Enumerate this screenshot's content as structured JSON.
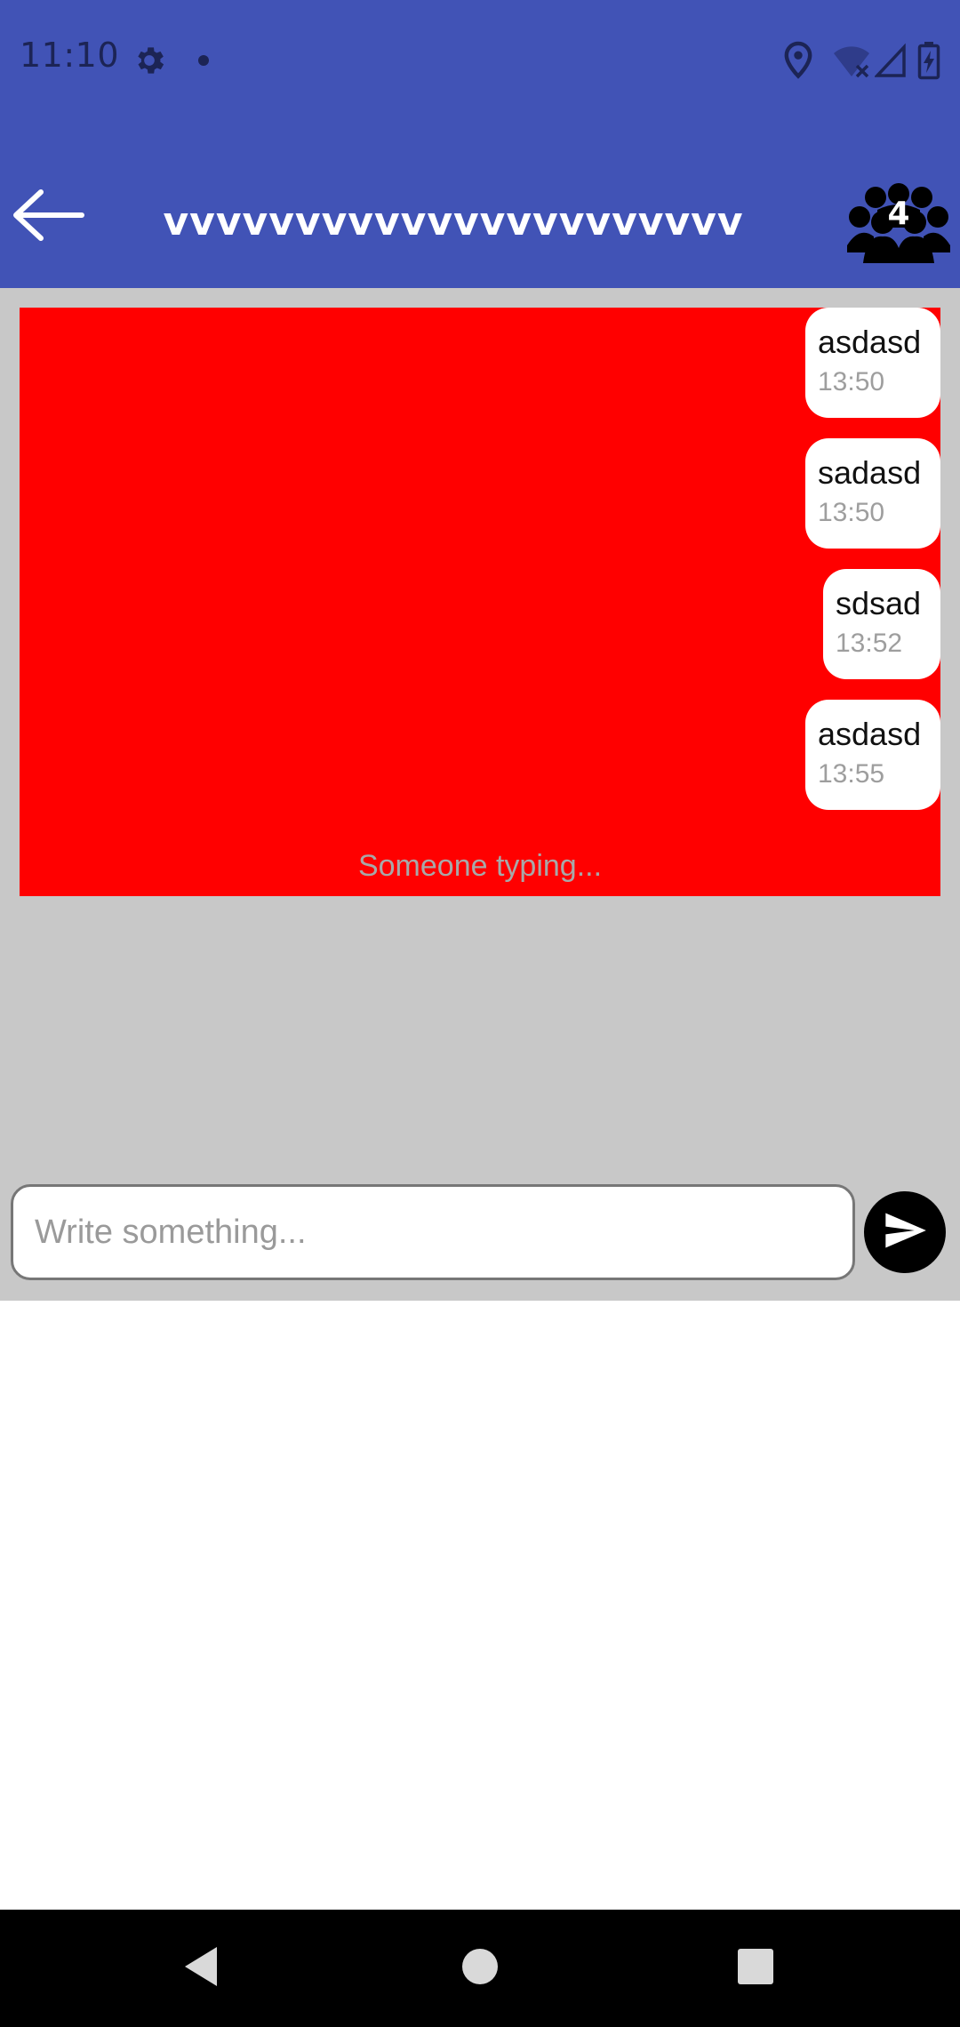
{
  "status_bar": {
    "time": "11:10",
    "icons": [
      "settings-icon",
      "notification-dot-icon",
      "location-icon",
      "wifi-off-icon",
      "cell-signal-icon",
      "battery-charging-icon"
    ]
  },
  "app_bar": {
    "title": "vvvvvvvvvvvvvvvvvvvvvv",
    "members_count": "4",
    "back_icon": "arrow-left-icon",
    "members_icon": "group-icon",
    "background_color": "#4153b6"
  },
  "chat": {
    "panel_color": "#ff0000",
    "messages": [
      {
        "text": "asdasd",
        "time": "13:50"
      },
      {
        "text": "sadasd",
        "time": "13:50"
      },
      {
        "text": "sdsad",
        "time": "13:52"
      },
      {
        "text": "asdasd",
        "time": "13:55"
      }
    ],
    "typing_text": "Someone typing..."
  },
  "composer": {
    "placeholder": "Write something...",
    "value": "",
    "send_icon": "send-icon"
  },
  "nav_bar": {
    "icons": [
      "back-triangle-icon",
      "home-circle-icon",
      "recents-square-icon"
    ]
  }
}
